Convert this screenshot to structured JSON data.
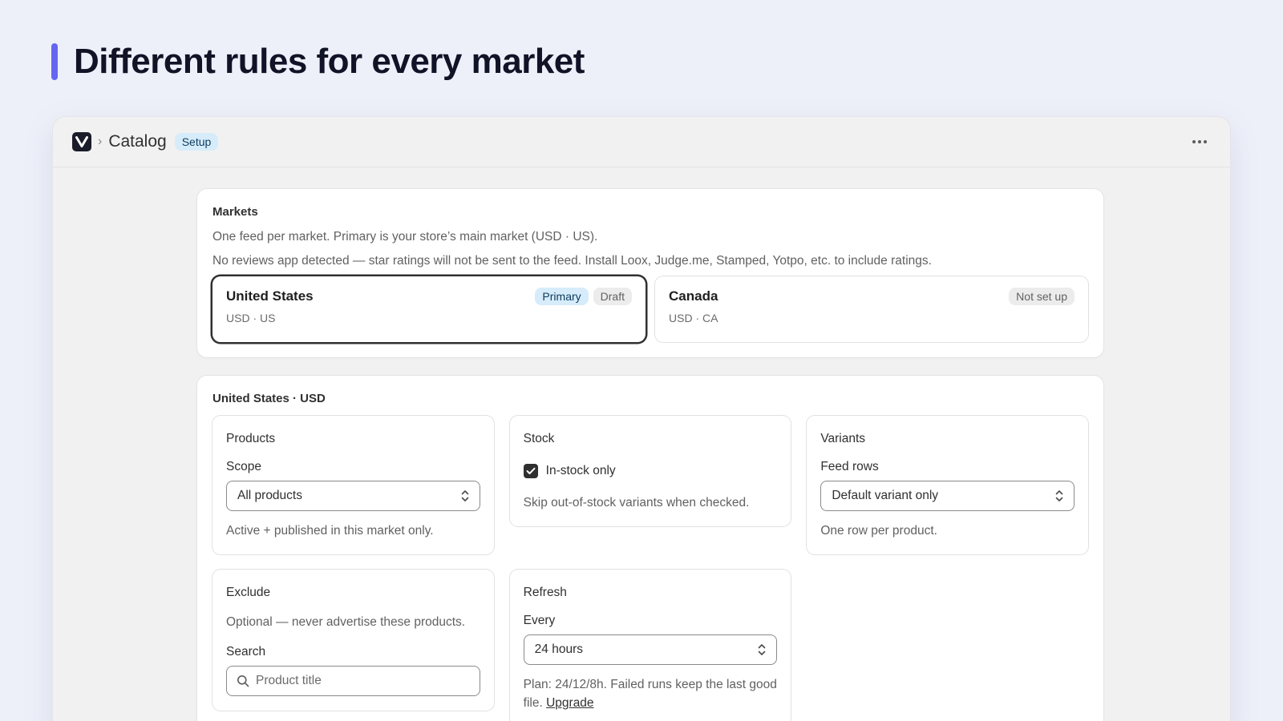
{
  "headline": "Different rules for every market",
  "colors": {
    "accent": "#6366f1",
    "primary_badge_bg": "#d6ecfa",
    "text": "#303030"
  },
  "topbar": {
    "logo_icon": "v-logo-icon",
    "title": "Catalog",
    "badge": "Setup",
    "more_icon": "more-horizontal-icon"
  },
  "markets": {
    "title": "Markets",
    "description": "One feed per market. Primary is your store’s main market (USD · US).",
    "warning": "No reviews app detected — star ratings will not be sent to the feed. Install Loox, Judge.me, Stamped, Yotpo, etc. to include ratings.",
    "items": [
      {
        "name": "United States",
        "sub": "USD · US",
        "badges": [
          "Primary",
          "Draft"
        ],
        "selected": true
      },
      {
        "name": "Canada",
        "sub": "USD · CA",
        "badges": [
          "Not set up"
        ],
        "selected": false
      }
    ]
  },
  "settings": {
    "title": "United States · USD",
    "products": {
      "title": "Products",
      "scope_label": "Scope",
      "scope_value": "All products",
      "help": "Active + published in this market only."
    },
    "stock": {
      "title": "Stock",
      "checkbox_label": "In-stock only",
      "checked": true,
      "help": "Skip out-of-stock variants when checked."
    },
    "variants": {
      "title": "Variants",
      "rows_label": "Feed rows",
      "rows_value": "Default variant only",
      "help": "One row per product."
    },
    "exclude": {
      "title": "Exclude",
      "help": "Optional — never advertise these products.",
      "search_label": "Search",
      "search_placeholder": "Product title"
    },
    "refresh": {
      "title": "Refresh",
      "every_label": "Every",
      "every_value": "24 hours",
      "help": "Plan: 24/12/8h. Failed runs keep the last good file.",
      "upgrade_link": "Upgrade"
    }
  }
}
